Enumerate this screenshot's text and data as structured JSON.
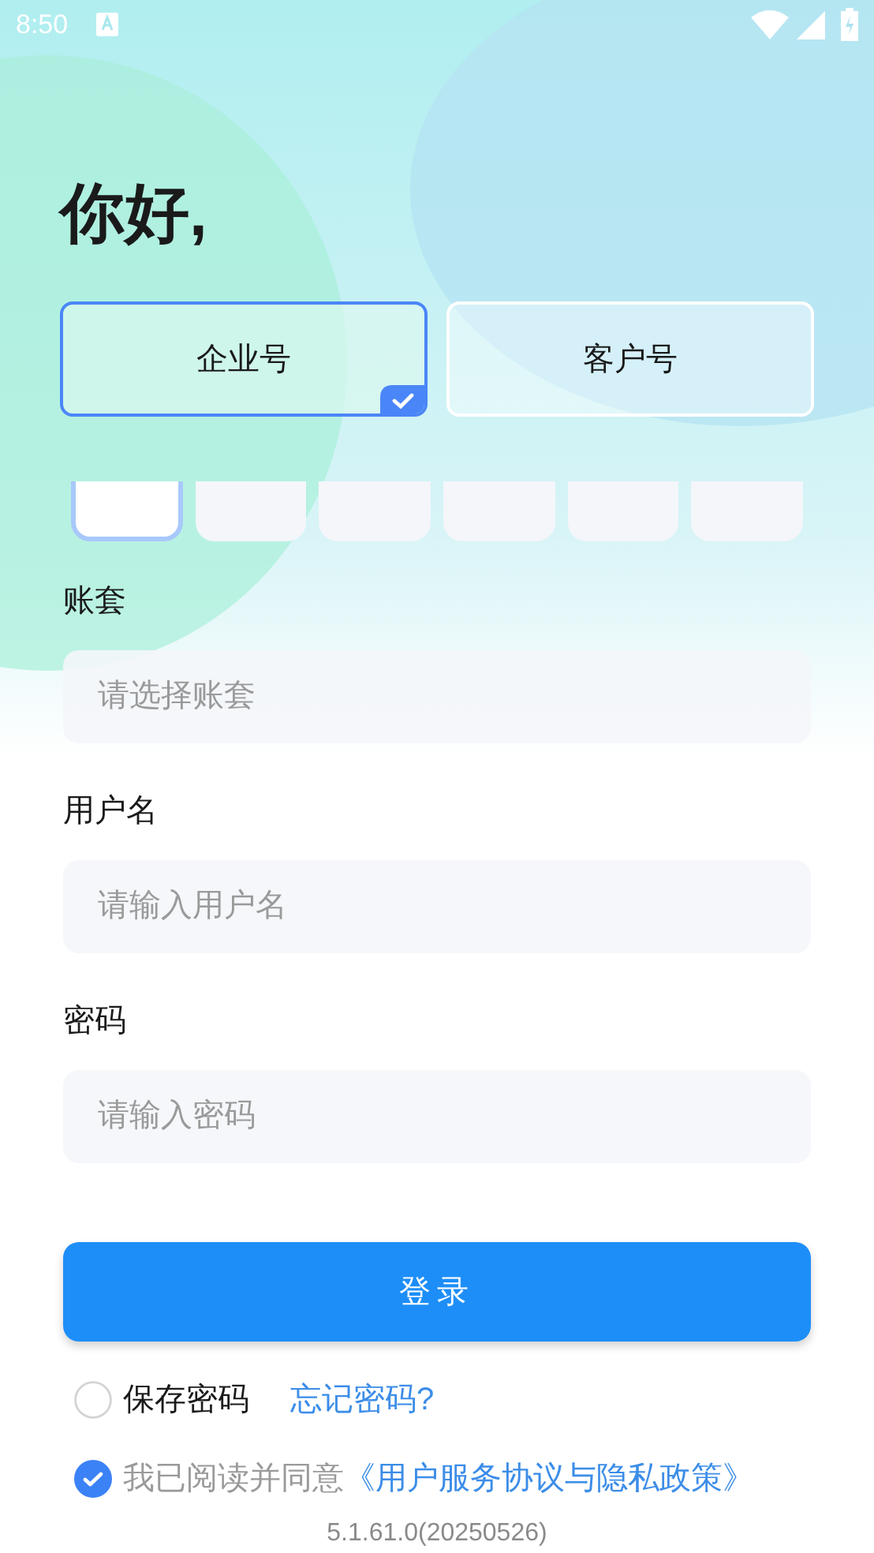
{
  "status_bar": {
    "time": "8:50"
  },
  "greeting": "你好,",
  "account_types": [
    {
      "label": "企业号",
      "selected": true
    },
    {
      "label": "客户号",
      "selected": false
    }
  ],
  "slots": [
    {
      "selected": true
    },
    {
      "selected": false
    },
    {
      "selected": false
    },
    {
      "selected": false
    },
    {
      "selected": false
    },
    {
      "selected": false
    }
  ],
  "fields": [
    {
      "label": "账套",
      "placeholder": "请选择账套"
    },
    {
      "label": "用户名",
      "placeholder": "请输入用户名"
    },
    {
      "label": "密码",
      "placeholder": "请输入密码"
    }
  ],
  "login_button": "登录",
  "save_password": {
    "label": "保存密码",
    "checked": false
  },
  "forgot_password": "忘记密码?",
  "agreement": {
    "text": "我已阅读并同意",
    "link": "《用户服务协议与隐私政策》",
    "checked": true
  },
  "version": "5.1.61.0(20250526)"
}
